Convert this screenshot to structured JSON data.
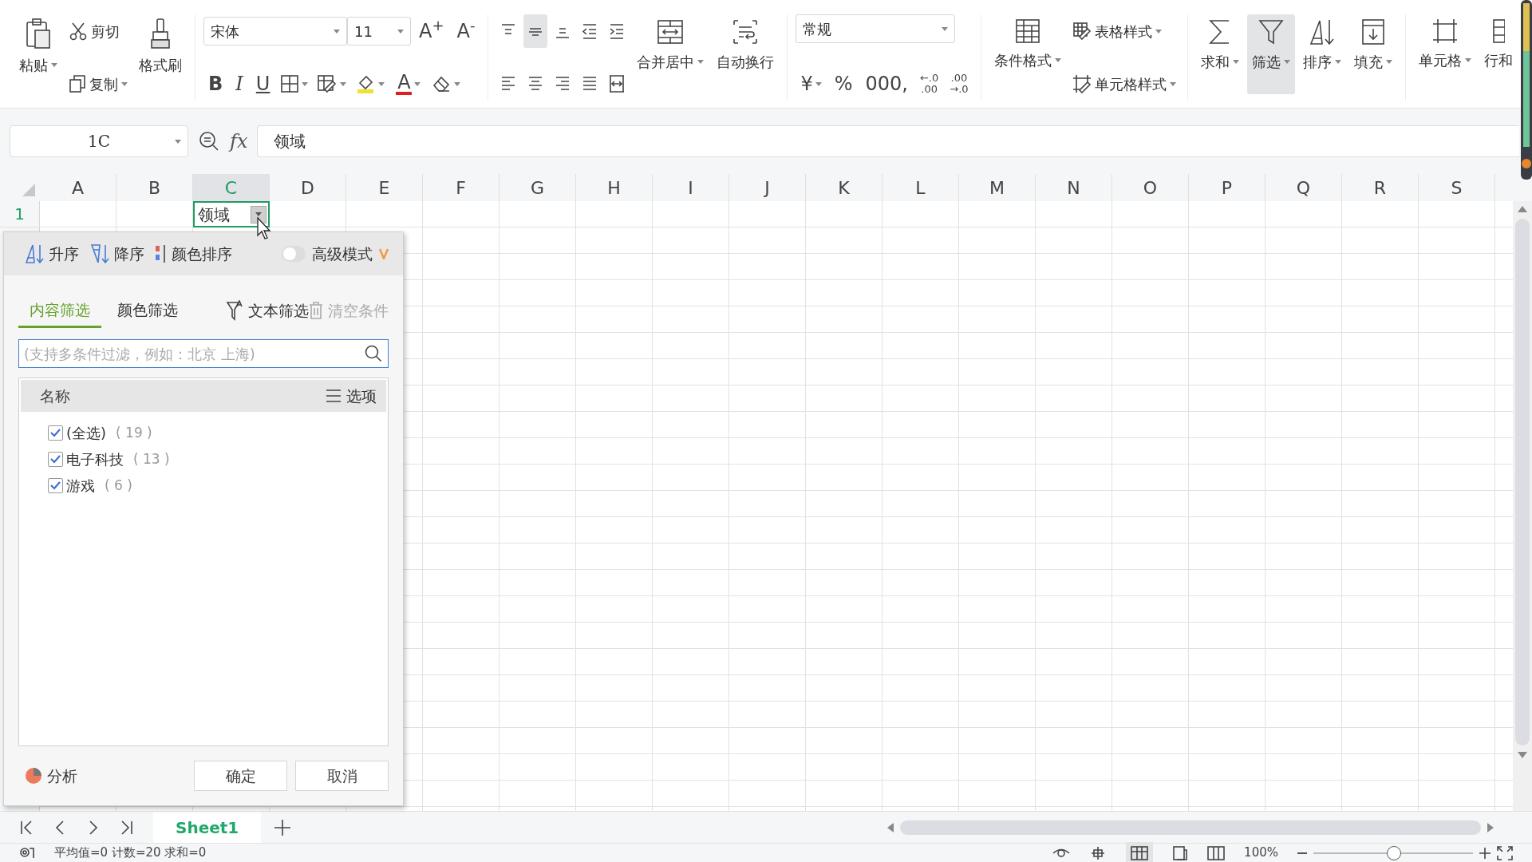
{
  "ribbon": {
    "paste": "粘贴",
    "cut": "剪切",
    "copy": "复制",
    "format_painter": "格式刷",
    "font_name": "宋体",
    "font_size": "11",
    "grow_font": "A$^{+}$",
    "shrink_font": "A$^{-}$",
    "bold": "B",
    "italic": "I",
    "underline": "U",
    "font_color": "A",
    "vertical_align": [
      {
        "selected": false
      },
      {
        "selected": true
      },
      {
        "selected": false
      }
    ],
    "merge_center": "合并居中",
    "wrap_text": "自动换行",
    "number_format": "常规",
    "currency": "¥",
    "percent": "%",
    "thousands": "000,",
    "increase_decimal": "←.0\n.00",
    "decrease_decimal": ".00\n→.0",
    "conditional_format": "条件格式",
    "table_style": "表格样式",
    "cell_style": "单元格样式",
    "sum": "求和",
    "filter": {
      "label": "筛选",
      "selected": true
    },
    "sort": "排序",
    "fill": "填充",
    "cell": "单元格",
    "rows_columns": "行和"
  },
  "formula_bar": {
    "name_box": "1C",
    "fx": "fx",
    "value": "领域"
  },
  "sheet": {
    "columns": [
      {
        "label": "A",
        "selected": false
      },
      {
        "label": "B",
        "selected": false
      },
      {
        "label": "C",
        "selected": true
      },
      {
        "label": "D",
        "selected": false
      },
      {
        "label": "E",
        "selected": false
      },
      {
        "label": "F",
        "selected": false
      },
      {
        "label": "G",
        "selected": false
      },
      {
        "label": "H",
        "selected": false
      },
      {
        "label": "I",
        "selected": false
      },
      {
        "label": "J",
        "selected": false
      },
      {
        "label": "K",
        "selected": false
      },
      {
        "label": "L",
        "selected": false
      },
      {
        "label": "M",
        "selected": false
      },
      {
        "label": "N",
        "selected": false
      },
      {
        "label": "O",
        "selected": false
      },
      {
        "label": "P",
        "selected": false
      },
      {
        "label": "Q",
        "selected": false
      },
      {
        "label": "R",
        "selected": false
      },
      {
        "label": "S",
        "selected": false
      }
    ],
    "rows": [
      {
        "label": "1",
        "selected": true,
        "cells": [
          {},
          {},
          {
            "text": "领域",
            "filter": true,
            "selected": true
          }
        ]
      }
    ]
  },
  "filter_panel": {
    "sort_buttons": [
      "升序",
      "降序",
      "颜色排序"
    ],
    "advanced_mode": {
      "label": "高级模式",
      "on": false
    },
    "tabs": [
      {
        "label": "内容筛选",
        "selected": true
      },
      {
        "label": "颜色筛选",
        "selected": false
      }
    ],
    "text_filter": "文本筛选",
    "clear": {
      "label": "清空条件",
      "disabled": true
    },
    "search": {
      "placeholder": "(支持多条件过滤，例如：北京 上海)"
    },
    "list_header": "名称",
    "options": "选项",
    "items": [
      {
        "label": "(全选)",
        "count": "( 19 )",
        "checked": true
      },
      {
        "label": "电子科技",
        "count": "( 13 )",
        "checked": true
      },
      {
        "label": "游戏",
        "count": "( 6 )",
        "checked": true
      }
    ],
    "analysis": "分析",
    "ok": "确定",
    "cancel": "取消"
  },
  "sheet_tabs": [
    {
      "label": "Sheet1",
      "selected": true
    }
  ],
  "status_bar": {
    "summary": "平均值=0 计数=20 求和=0",
    "zoom": "100%"
  }
}
